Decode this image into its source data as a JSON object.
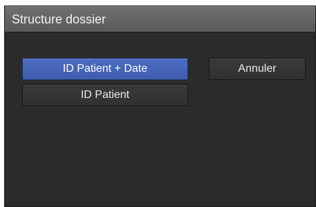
{
  "dialog": {
    "title": "Structure dossier",
    "options": {
      "patient_id_date": "ID Patient + Date",
      "patient_id": "ID Patient"
    },
    "selected_option": "patient_id_date",
    "cancel_label": "Annuler"
  },
  "colors": {
    "dialog_background": "#2b2b2b",
    "title_bar": "#666666",
    "selected_button": "#4565b5",
    "button": "#353535",
    "text": "#ececec"
  }
}
